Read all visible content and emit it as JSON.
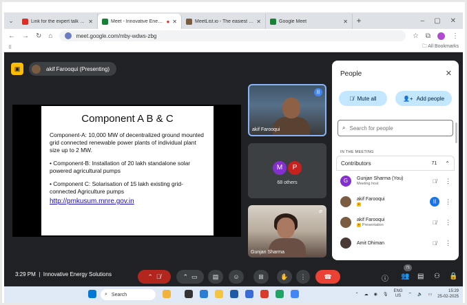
{
  "browser": {
    "tabs": [
      {
        "label": "Link for the expert talk on Inno",
        "color": "#d93025"
      },
      {
        "label": "Meet - Innovative Energy S",
        "color": "#188038",
        "active": true
      },
      {
        "label": "MeetList.io - The easiest way to",
        "color": "#7a5c43"
      },
      {
        "label": "Google Meet",
        "color": "#188038"
      }
    ],
    "url": "meet.google.com/mby-wdws-zbg",
    "all_bookmarks": "All Bookmarks"
  },
  "meet": {
    "presenter_label": "akif Farooqui (Presenting)",
    "slide": {
      "title": "Component A B & C",
      "para1": "Component-A: 10,000 MW of decentralized ground mounted grid connected renewable power plants of individual plant size up to 2 MW.",
      "para2": "• Component-B: Installation of 20 lakh standalone solar powered agricultural pumps",
      "para3": "• Component C: Solarisation of 15 lakh existing grid-connected Agriculture pumps",
      "link": "http://pmkusum.mnre.gov.in"
    },
    "tiles": {
      "tile1_name": "akif Farooqui",
      "others_label": "68 others",
      "av_m": "M",
      "av_p": "P",
      "tile3_name": "Gunjan Sharma"
    },
    "clock": "3:29 PM",
    "meeting_name": "Innovative Energy Solutions",
    "people_badge": "71"
  },
  "people": {
    "title": "People",
    "mute_all": "Mute all",
    "add_people": "Add people",
    "search_placeholder": "Search for people",
    "section": "IN THE MEETING",
    "contributors": "Contributors",
    "contributors_count": "71",
    "rows": [
      {
        "name": "Gunjan Sharma (You)",
        "sub": "Meeting host",
        "initial": "G",
        "color": "#8430ce"
      },
      {
        "name": "akif Farooqui",
        "sub": "",
        "tag": "▪",
        "initial": "",
        "color": "#7a5c43"
      },
      {
        "name": "akif Farooqui",
        "sub": "Presentation",
        "tag": "▪",
        "initial": "",
        "color": "#7a5c43"
      },
      {
        "name": "Amit Dhiman",
        "sub": "",
        "initial": "",
        "color": "#4a3a35"
      }
    ]
  },
  "taskbar": {
    "search": "Search",
    "lang_top": "ENG",
    "lang_bottom": "US",
    "time": "15:29",
    "date": "25-02-2025"
  },
  "colors": {
    "meet_bg": "#202124",
    "accent_blue": "#1a73e8",
    "leave_red": "#ea4335",
    "pill_blue": "#c2e7ff"
  }
}
